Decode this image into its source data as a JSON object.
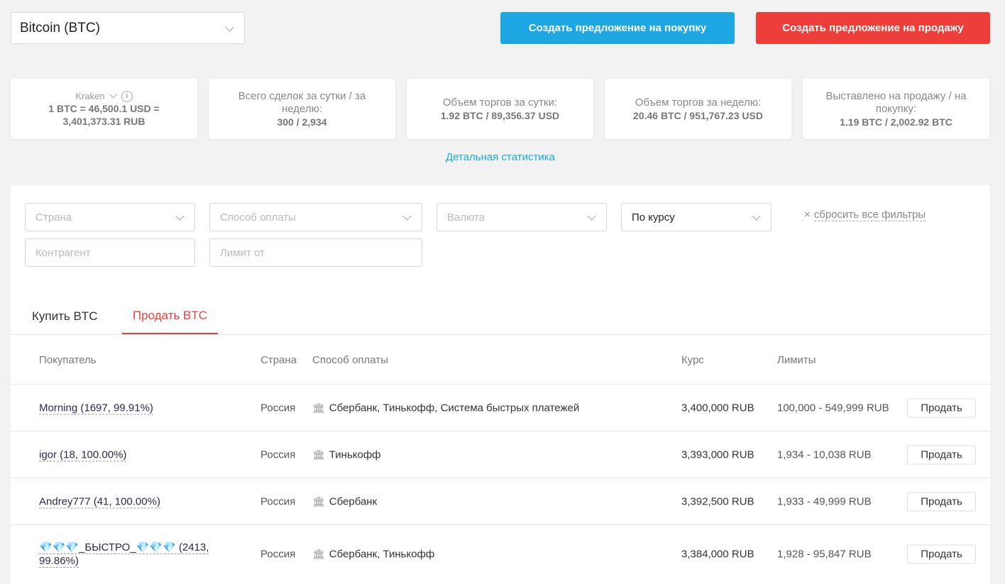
{
  "currency": {
    "label": "Bitcoin (BTC)"
  },
  "actions": {
    "buy_label": "Создать предложение на покупку",
    "sell_label": "Создать предложение на продажу"
  },
  "stats": {
    "source": "Kraken",
    "rate_line1": "1 BTC = 46,500.1 USD =",
    "rate_line2": "3,401,373.31 RUB",
    "deals_label": "Всего сделок за сутки / за неделю:",
    "deals_value": "300 / 2,934",
    "volume_day_label": "Объем торгов за сутки:",
    "volume_day_value": "1.92 BTC / 89,356.37 USD",
    "volume_week_label": "Объем торгов за неделю:",
    "volume_week_value": "20.46 BTC / 951,767.23 USD",
    "listed_label": "Выставлено на продажу / на покупку:",
    "listed_value": "1.19 BTC / 2,002.92 BTC"
  },
  "detail_link": "Детальная статистика",
  "filters": {
    "country_placeholder": "Страна",
    "payment_placeholder": "Способ оплаты",
    "currency_placeholder": "Валюта",
    "sort_value": "По курсу",
    "counterparty_placeholder": "Контрагент",
    "limit_placeholder": "Лимит от",
    "reset_icon": "×",
    "reset_label": "сбросить все фильтры"
  },
  "tabs": {
    "buy": "Купить BTC",
    "sell": "Продать BTC"
  },
  "table": {
    "headers": {
      "buyer": "Покупатель",
      "country": "Страна",
      "payment": "Способ оплаты",
      "rate": "Курс",
      "limits": "Лимиты"
    },
    "action_label": "Продать",
    "rows": [
      {
        "buyer": "Morning (1697, 99.91%)",
        "country": "Россия",
        "payment": "Сбербанк, Тинькофф, Система быстрых платежей",
        "rate": "3,400,000 RUB",
        "limits": "100,000 - 549,999 RUB"
      },
      {
        "buyer": "igor (18, 100.00%)",
        "country": "Россия",
        "payment": "Тинькофф",
        "rate": "3,393,000 RUB",
        "limits": "1,934 - 10,038 RUB"
      },
      {
        "buyer": "Andrey777 (41, 100.00%)",
        "country": "Россия",
        "payment": "Сбербанк",
        "rate": "3,392,500 RUB",
        "limits": "1,933 - 49,999 RUB"
      },
      {
        "buyer_line1": "💎💎💎_БЫСТРО_💎💎💎 (2413,",
        "buyer_line2": "99.86%)",
        "country": "Россия",
        "payment": "Сбербанк, Тинькофф",
        "rate": "3,384,000 RUB",
        "limits": "1,928 - 95,847 RUB"
      }
    ]
  },
  "icons": {
    "bank": "🏛"
  }
}
